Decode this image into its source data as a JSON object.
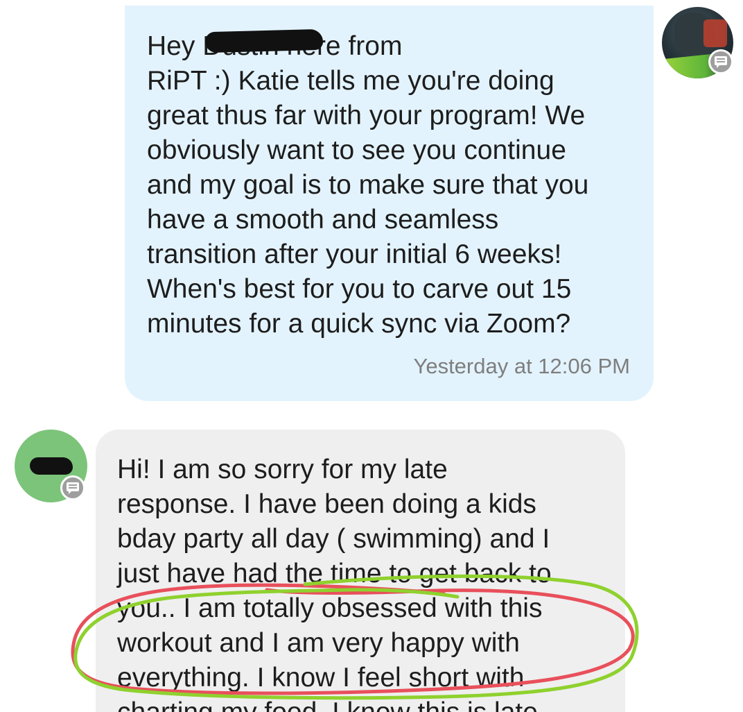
{
  "messages": {
    "outgoing": {
      "text": "Hey        Dustin here from\nRiPT :) Katie tells me you're doing\ngreat thus far with your program! We\nobviously want to see you continue\nand my goal is to make sure that you\nhave a smooth and seamless\ntransition after your initial 6 weeks!\nWhen's best for you to carve out 15\nminutes for a quick sync via Zoom?",
      "timestamp": "Yesterday at 12:06 PM"
    },
    "incoming": {
      "text": "Hi! I am so sorry for my late\nresponse. I have been doing a kids\nbday party all day ( swimming) and I\njust have had the time to get back to\nyou.. I am totally obsessed with this\nworkout and I am very happy with\neverything. I know I feel short with\ncharting my food. I know this is late"
    }
  },
  "icons": {
    "sender_avatar": "profile-photo",
    "recipient_avatar": "profile-photo-redacted",
    "badge": "message-icon"
  },
  "colors": {
    "outgoing_bubble": "#e3f3fd",
    "incoming_bubble": "#efefef",
    "timestamp": "#7e7e7e",
    "annotation_red": "#e8505b",
    "annotation_green": "#8fd12e",
    "recipient_avatar_bg": "#7cc47a"
  }
}
